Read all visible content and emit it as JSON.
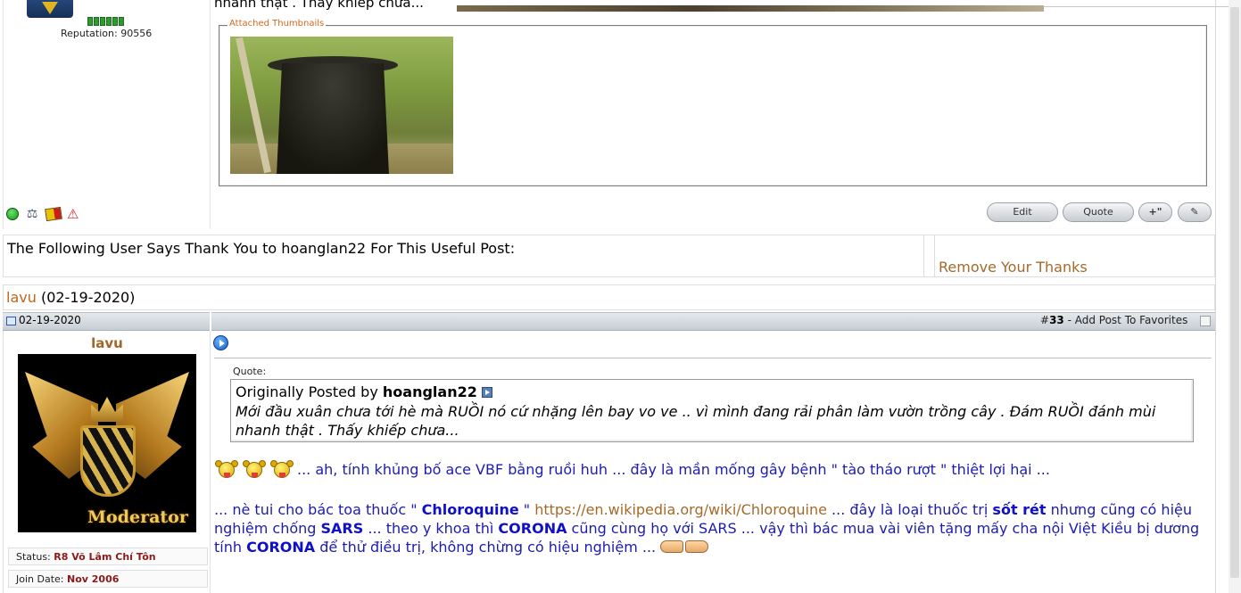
{
  "previous_post": {
    "snippet": "nhanh thật . Thấy khiếp chưa...",
    "reputation": "Reputation: 90556",
    "attachment_legend": "Attached Thumbnails",
    "buttons": {
      "edit": "Edit",
      "quote": "Quote",
      "multiquote": "+\""
    },
    "status_icons": [
      "online-icon",
      "scale-icon",
      "yellow-red-card-icon",
      "warning-icon"
    ]
  },
  "thanks": {
    "heading": "The Following User Says Thank You to hoanglan22 For This Useful Post:",
    "remove": "Remove Your Thanks",
    "thanker_name": "lavu",
    "thanker_date": "(02-19-2020)"
  },
  "post": {
    "date": "02-19-2020",
    "number_prefix": "#",
    "number": "33",
    "favorites": " - Add Post To Favorites",
    "username": "lavu",
    "avatar_label": "Moderator",
    "status_label": "Status:",
    "status_value": "R8 Võ Lâm Chí Tôn",
    "join_label": "Join Date:",
    "join_value": "Nov 2006",
    "quote_label": "Quote:",
    "quote_prefix": "Originally Posted by",
    "quote_author": "hoanglan22",
    "quote_text": "Mới đầu xuân chưa tới hè mà RUỒI nó cứ nhặng lên bay vo ve .. vì mình đang rải phân làm vườn trồng cây . Đám RUỒI đánh mùi nhanh thật . Thấy khiếp chưa...",
    "line1": "... ah, tính khủng bố ace VBF bằng ruồi huh ... đây là mần mống gây bệnh \" tào tháo rượt \" thiệt lợi hại ...",
    "p_a": "... nè tui cho bác toa thuốc \" ",
    "p_chloro": "Chloroquine",
    "p_b": " \" ",
    "p_link": "https://en.wikipedia.org/wiki/Chloroquine",
    "p_c": " ... đây là loại thuốc trị ",
    "p_sotret": "sốt rét",
    "p_d": " nhưng cũng có hiệu nghiệm chống ",
    "p_sars": "SARS",
    "p_e": " ... theo y khoa thì ",
    "p_corona1": "CORONA",
    "p_f": " cũng cùng họ với SARS ... vậy thì bác mua vài viên tặng mấy cha nội Việt Kiều bị dương tính ",
    "p_corona2": "CORONA",
    "p_g": " để thử điều trị, không chừng có hiệu nghiệm ... "
  }
}
